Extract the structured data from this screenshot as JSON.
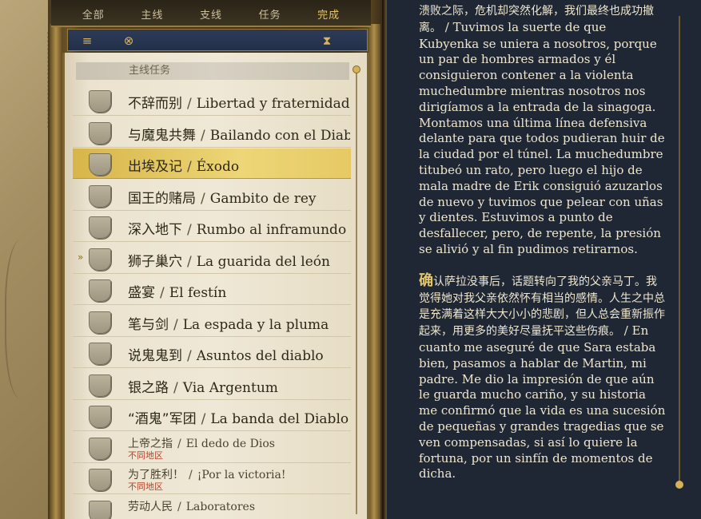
{
  "tabs": [
    {
      "label": "全部"
    },
    {
      "label": "主线"
    },
    {
      "label": "支线"
    },
    {
      "label": "任务"
    },
    {
      "label": "完成"
    }
  ],
  "toolbar": {
    "icons": [
      "filter-icon",
      "map-marker-icon",
      "hourglass-icon"
    ]
  },
  "list": {
    "section_title": "主线任务",
    "quests": [
      {
        "zh": "不辞而别",
        "es": "Libertad y fraternidad"
      },
      {
        "zh": "与魔鬼共舞",
        "es": "Bailando con el Diablo"
      },
      {
        "zh": "出埃及记",
        "es": "Éxodo"
      },
      {
        "zh": "国王的赌局",
        "es": "Gambito de rey"
      },
      {
        "zh": "深入地下",
        "es": "Rumbo al inframundo"
      },
      {
        "zh": "狮子巢穴",
        "es": "La guarida del león"
      },
      {
        "zh": "盛宴",
        "es": "El festín"
      },
      {
        "zh": "笔与剑",
        "es": "La espada y la pluma"
      },
      {
        "zh": "说鬼鬼到",
        "es": "Asuntos del diablo"
      },
      {
        "zh": "银之路",
        "es": "Via Argentum"
      },
      {
        "zh": "“酒鬼”军团",
        "es": "La banda del Diablo"
      },
      {
        "zh": "上帝之指",
        "es": "El dedo de Dios",
        "sub": "不同地区"
      },
      {
        "zh": "为了胜利！",
        "es": "¡Por la victoria!",
        "sub": "不同地区"
      },
      {
        "zh": "劳动人民",
        "es": "Laboratores"
      }
    ],
    "separator": "/",
    "selected_index": 2,
    "pointer_index": 5,
    "pointer_glyph": "»"
  },
  "description": {
    "p1_zh": "溃败之际，危机却突然化解，我们最终也成功撤离。",
    "p1_es": "Tuvimos la suerte de que Kubyenka se uniera a nosotros, porque un par de hombres armados y él consiguieron contener a la violenta muchedumbre mientras nosotros nos dirigíamos a la entrada de la sinagoga. Montamos una última línea defensiva delante para que todos pudieran huir de la ciudad por el túnel. La muchedumbre titubeó un rato, pero luego el hijo de mala madre de Erik consiguió azuzarlos de nuevo y tuvimos que pelear con uñas y dientes. Estuvimos a punto de desfallecer, pero, de repente, la presión se alivió y al fin pudimos retirarnos.",
    "p2_dropcap": "确",
    "p2_zh": "认萨拉没事后，话题转向了我的父亲马丁。我觉得她对我父亲依然怀有相当的感情。人生之中总是充满着这样大大小小的悲剧，但人总会重新振作起来，用更多的美好尽量抚平这些伤痕。",
    "p2_es": "En cuanto me aseguré de que Sara estaba bien, pasamos a hablar de Martin, mi padre. Me dio la impresión de que aún le guarda mucho cariño, y su historia me confirmó que la vida es una sucesión de pequeñas y grandes tragedias que se ven compensadas, si así lo quiere la fortuna, por un sinfín de momentos de dicha.",
    "sep": "/"
  },
  "colors": {
    "accent_gold": "#e4c66b",
    "selected_row": "#edd677",
    "desc_bg": "#1e2733",
    "region_text": "#b0452c"
  }
}
